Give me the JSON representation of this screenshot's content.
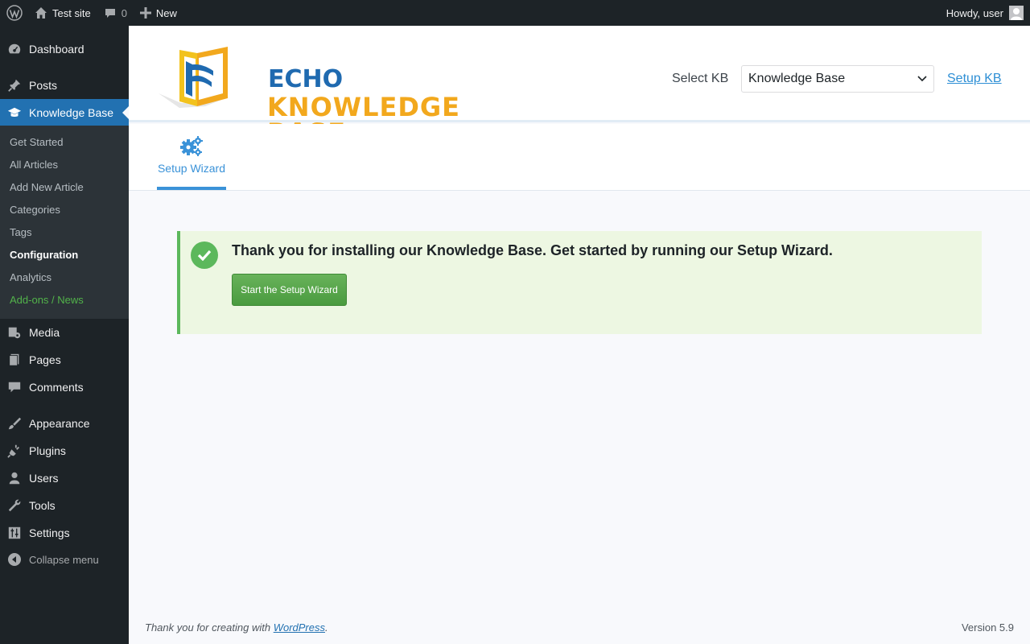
{
  "adminbar": {
    "site_name": "Test site",
    "comments_count": "0",
    "new_label": "New",
    "howdy": "Howdy, user"
  },
  "sidebar": {
    "dashboard": "Dashboard",
    "posts": "Posts",
    "knowledge_base": "Knowledge Base",
    "submenu": [
      "Get Started",
      "All Articles",
      "Add New Article",
      "Categories",
      "Tags",
      "Configuration",
      "Analytics",
      "Add-ons / News"
    ],
    "media": "Media",
    "pages": "Pages",
    "comments": "Comments",
    "appearance": "Appearance",
    "plugins": "Plugins",
    "users": "Users",
    "tools": "Tools",
    "settings": "Settings",
    "collapse": "Collapse menu"
  },
  "header": {
    "logo_line1": "ECHO",
    "logo_line2": "KNOWLEDGE BASE",
    "select_kb_label": "Select KB",
    "selected_kb": "Knowledge Base",
    "setup_kb_link": "Setup KB"
  },
  "tabs": {
    "setup_wizard": "Setup Wizard"
  },
  "notice": {
    "message": "Thank you for installing our Knowledge Base. Get started by running our Setup Wizard.",
    "button": "Start the Setup Wizard"
  },
  "footer": {
    "thanks_prefix": "Thank you for creating with",
    "wordpress_link": "WordPress",
    "thanks_suffix": ".",
    "version": "Version 5.9"
  },
  "colors": {
    "admin_dark": "#1d2327",
    "wp_blue": "#2271b1",
    "success_green": "#5cb85c",
    "notice_bg": "#edf7e2",
    "logo_blue": "#1f6ab0",
    "logo_orange": "#f2a81d",
    "tab_blue": "#3a92d8"
  }
}
